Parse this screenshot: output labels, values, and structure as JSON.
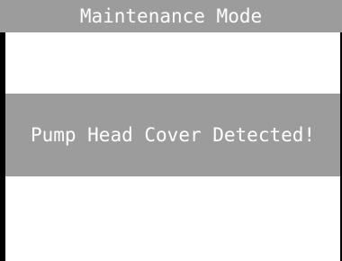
{
  "header": {
    "title": "Maintenance Mode"
  },
  "alert": {
    "message": "Pump Head Cover Detected!"
  },
  "colors": {
    "header_background": "#9c9c9c",
    "banner_background": "#9c9c9c",
    "text": "#ffffff",
    "border": "#000000",
    "background": "#ffffff"
  }
}
